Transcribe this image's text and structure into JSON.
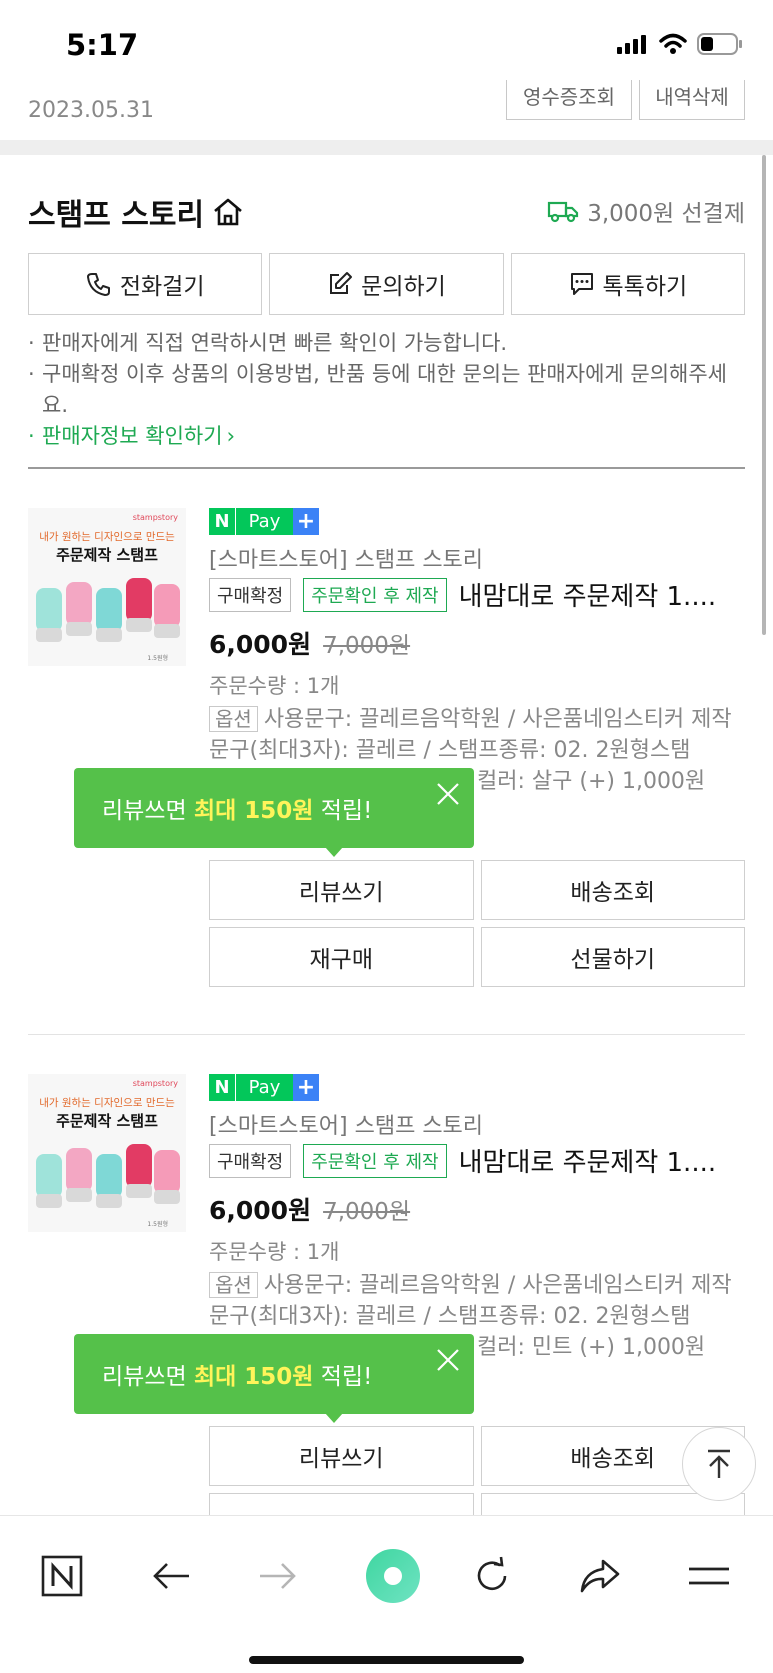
{
  "status_bar": {
    "time": "5:17"
  },
  "header": {
    "date": "2023.05.31",
    "receipt_button": "영수증조회",
    "delete_button": "내역삭제"
  },
  "seller": {
    "name": "스탬프 스토리",
    "shipping": "3,000원 선결제",
    "buttons": {
      "call": "전화걸기",
      "inquiry": "문의하기",
      "talk": "톡톡하기"
    },
    "notes": [
      "판매자에게 직접 연락하시면 빠른 확인이 가능합니다.",
      "구매확정 이후 상품의 이용방법, 반품 등에 대한 문의는 판매자에게 문의해주세요."
    ],
    "seller_info_link": "판매자정보 확인하기"
  },
  "thumbnail": {
    "brand": "stampstory",
    "line1": "내가 원하는 디자인으로 만드는",
    "line2": "주문제작 스탬프",
    "caption": "1.5원형"
  },
  "npay": {
    "n": "N",
    "pay": "Pay",
    "plus": "+"
  },
  "orders": [
    {
      "store": "[스마트스토어] 스탬프 스토리",
      "badge_confirmed": "구매확정",
      "badge_made": "주문확인 후 제작",
      "title": "내맘대로 주문제작 1....",
      "price": "6,000원",
      "original_price": "7,000원",
      "quantity": "주문수량 : 1개",
      "option_tag": "옵션",
      "option_text": "사용문구: 끌레르음악학원 / 사은품네임스티커 제작문구(최대3자): 끌레르 / 스탬프종류: 02. 2원형스탬",
      "option_tail": "컬러: 살구 (+) 1,000원",
      "tooltip": {
        "pre": "리뷰쓰면 ",
        "highlight": "최대 150원",
        "post": " 적립!"
      },
      "actions": {
        "review": "리뷰쓰기",
        "tracking": "배송조회",
        "rebuy": "재구매",
        "gift": "선물하기"
      }
    },
    {
      "store": "[스마트스토어] 스탬프 스토리",
      "badge_confirmed": "구매확정",
      "badge_made": "주문확인 후 제작",
      "title": "내맘대로 주문제작 1....",
      "price": "6,000원",
      "original_price": "7,000원",
      "quantity": "주문수량 : 1개",
      "option_tag": "옵션",
      "option_text": "사용문구: 끌레르음악학원 / 사은품네임스티커 제작문구(최대3자): 끌레르 / 스탬프종류: 02. 2원형스탬",
      "option_tail": "컬러: 민트 (+) 1,000원",
      "tooltip": {
        "pre": "리뷰쓰면 ",
        "highlight": "최대 150원",
        "post": " 적립!"
      },
      "actions": {
        "review": "리뷰쓰기",
        "tracking": "배송조회"
      }
    }
  ],
  "colors": {
    "naver_green": "#03c75a",
    "link_green": "#1ea952",
    "tooltip_green": "#55c14a",
    "highlight_yellow": "#fff45a"
  }
}
